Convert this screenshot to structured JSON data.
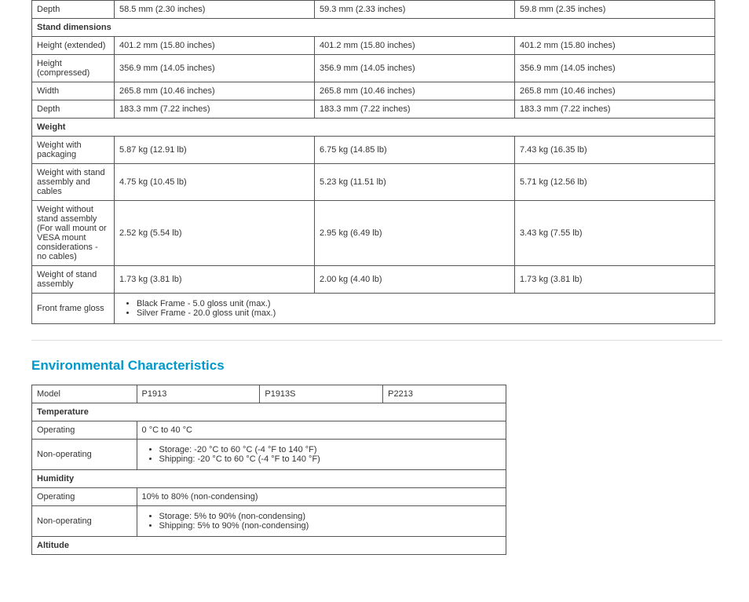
{
  "physical": {
    "depth_label": "Depth",
    "depth": [
      "58.5 mm (2.30 inches)",
      "59.3 mm (2.33 inches)",
      "59.8 mm (2.35 inches)"
    ],
    "stand_header": "Stand dimensions",
    "hext_label": "Height (extended)",
    "hext": [
      "401.2 mm (15.80 inches)",
      "401.2 mm (15.80 inches)",
      "401.2 mm (15.80 inches)"
    ],
    "hcomp_label": "Height (compressed)",
    "hcomp": [
      "356.9 mm (14.05 inches)",
      "356.9 mm (14.05 inches)",
      "356.9 mm (14.05 inches)"
    ],
    "width_label": "Width",
    "width": [
      "265.8 mm (10.46 inches)",
      "265.8 mm (10.46 inches)",
      "265.8 mm (10.46 inches)"
    ],
    "sdepth_label": "Depth",
    "sdepth": [
      "183.3 mm (7.22 inches)",
      "183.3 mm (7.22 inches)",
      "183.3 mm (7.22 inches)"
    ],
    "weight_header": "Weight",
    "wpkg_label": "Weight with packaging",
    "wpkg": [
      "5.87 kg (12.91 lb)",
      "6.75 kg (14.85 lb)",
      "7.43 kg (16.35 lb)"
    ],
    "wstand_label": "Weight with stand assembly and cables",
    "wstand": [
      "4.75 kg (10.45 lb)",
      "5.23 kg (11.51 lb)",
      "5.71 kg (12.56 lb)"
    ],
    "wnostand_label": "Weight without stand assembly (For wall mount or VESA mount considerations - no cables)",
    "wnostand": [
      "2.52 kg (5.54 lb)",
      "2.95 kg (6.49 lb)",
      "3.43 kg (7.55 lb)"
    ],
    "wassm_label": "Weight of stand assembly",
    "wassm": [
      "1.73 kg (3.81 lb)",
      "2.00 kg (4.40 lb)",
      "1.73 kg (3.81 lb)"
    ],
    "gloss_label": "Front frame gloss",
    "gloss": [
      "Black Frame - 5.0 gloss unit (max.)",
      "Silver Frame - 20.0 gloss unit (max.)"
    ]
  },
  "env": {
    "heading": "Environmental Characteristics",
    "model_label": "Model",
    "models": [
      "P1913",
      "P1913S",
      "P2213"
    ],
    "temp_header": "Temperature",
    "temp_op_label": "Operating",
    "temp_op": "0 °C to 40 °C",
    "temp_nonop_label": "Non-operating",
    "temp_nonop": [
      "Storage: -20 °C to 60 °C (-4 °F to 140 °F)",
      "Shipping: -20 °C to 60 °C (-4 °F to 140 °F)"
    ],
    "hum_header": "Humidity",
    "hum_op_label": "Operating",
    "hum_op": "10% to 80% (non-condensing)",
    "hum_nonop_label": "Non-operating",
    "hum_nonop": [
      "Storage: 5% to 90% (non-condensing)",
      "Shipping: 5% to 90% (non-condensing)"
    ],
    "alt_header": "Altitude"
  }
}
